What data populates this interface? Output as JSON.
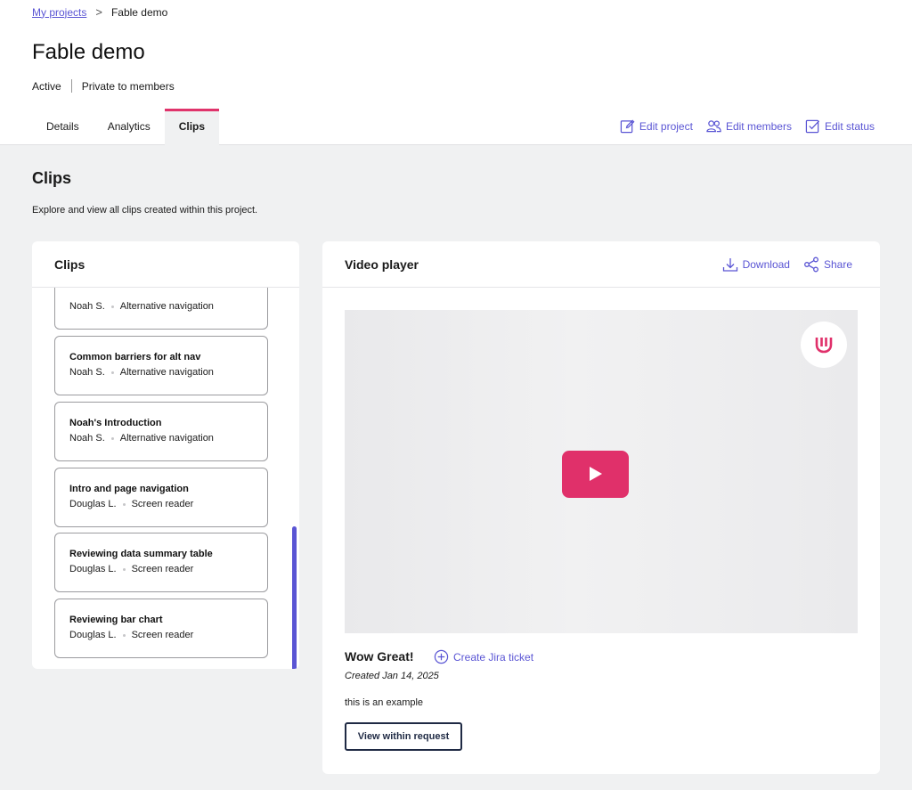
{
  "breadcrumb": {
    "parent": "My projects",
    "separator": ">",
    "current": "Fable demo"
  },
  "project": {
    "title": "Fable demo",
    "status": "Active",
    "visibility": "Private to members"
  },
  "tabs": [
    {
      "label": "Details",
      "active": false
    },
    {
      "label": "Analytics",
      "active": false
    },
    {
      "label": "Clips",
      "active": true
    }
  ],
  "header_actions": {
    "edit_project": "Edit project",
    "edit_members": "Edit members",
    "edit_status": "Edit status"
  },
  "section": {
    "title": "Clips",
    "description": "Explore and view all clips created within this project."
  },
  "clips_panel": {
    "title": "Clips",
    "items": [
      {
        "title": "",
        "author": "Noah S.",
        "category": "Alternative navigation"
      },
      {
        "title": "Common barriers for alt nav",
        "author": "Noah S.",
        "category": "Alternative navigation"
      },
      {
        "title": "Noah's Introduction",
        "author": "Noah S.",
        "category": "Alternative navigation"
      },
      {
        "title": "Intro and page navigation",
        "author": "Douglas L.",
        "category": "Screen reader"
      },
      {
        "title": "Reviewing data summary table",
        "author": "Douglas L.",
        "category": "Screen reader"
      },
      {
        "title": "Reviewing bar chart",
        "author": "Douglas L.",
        "category": "Screen reader"
      }
    ]
  },
  "video_panel": {
    "title": "Video player",
    "download": "Download",
    "share": "Share",
    "clip_name": "Wow Great!",
    "jira": "Create Jira ticket",
    "created": "Created Jan 14, 2025",
    "description": "this is an example",
    "view_button": "View within request"
  },
  "colors": {
    "accent": "#5a55d4",
    "brand": "#e0306a",
    "background": "#f0f1f2"
  },
  "icons": {
    "edit_project": "edit-pencil-icon",
    "edit_members": "users-icon",
    "edit_status": "checkbox-icon",
    "download": "download-icon",
    "share": "share-icon",
    "jira": "plus-circle-icon",
    "play": "play-icon",
    "logo": "fable-logo-icon"
  }
}
